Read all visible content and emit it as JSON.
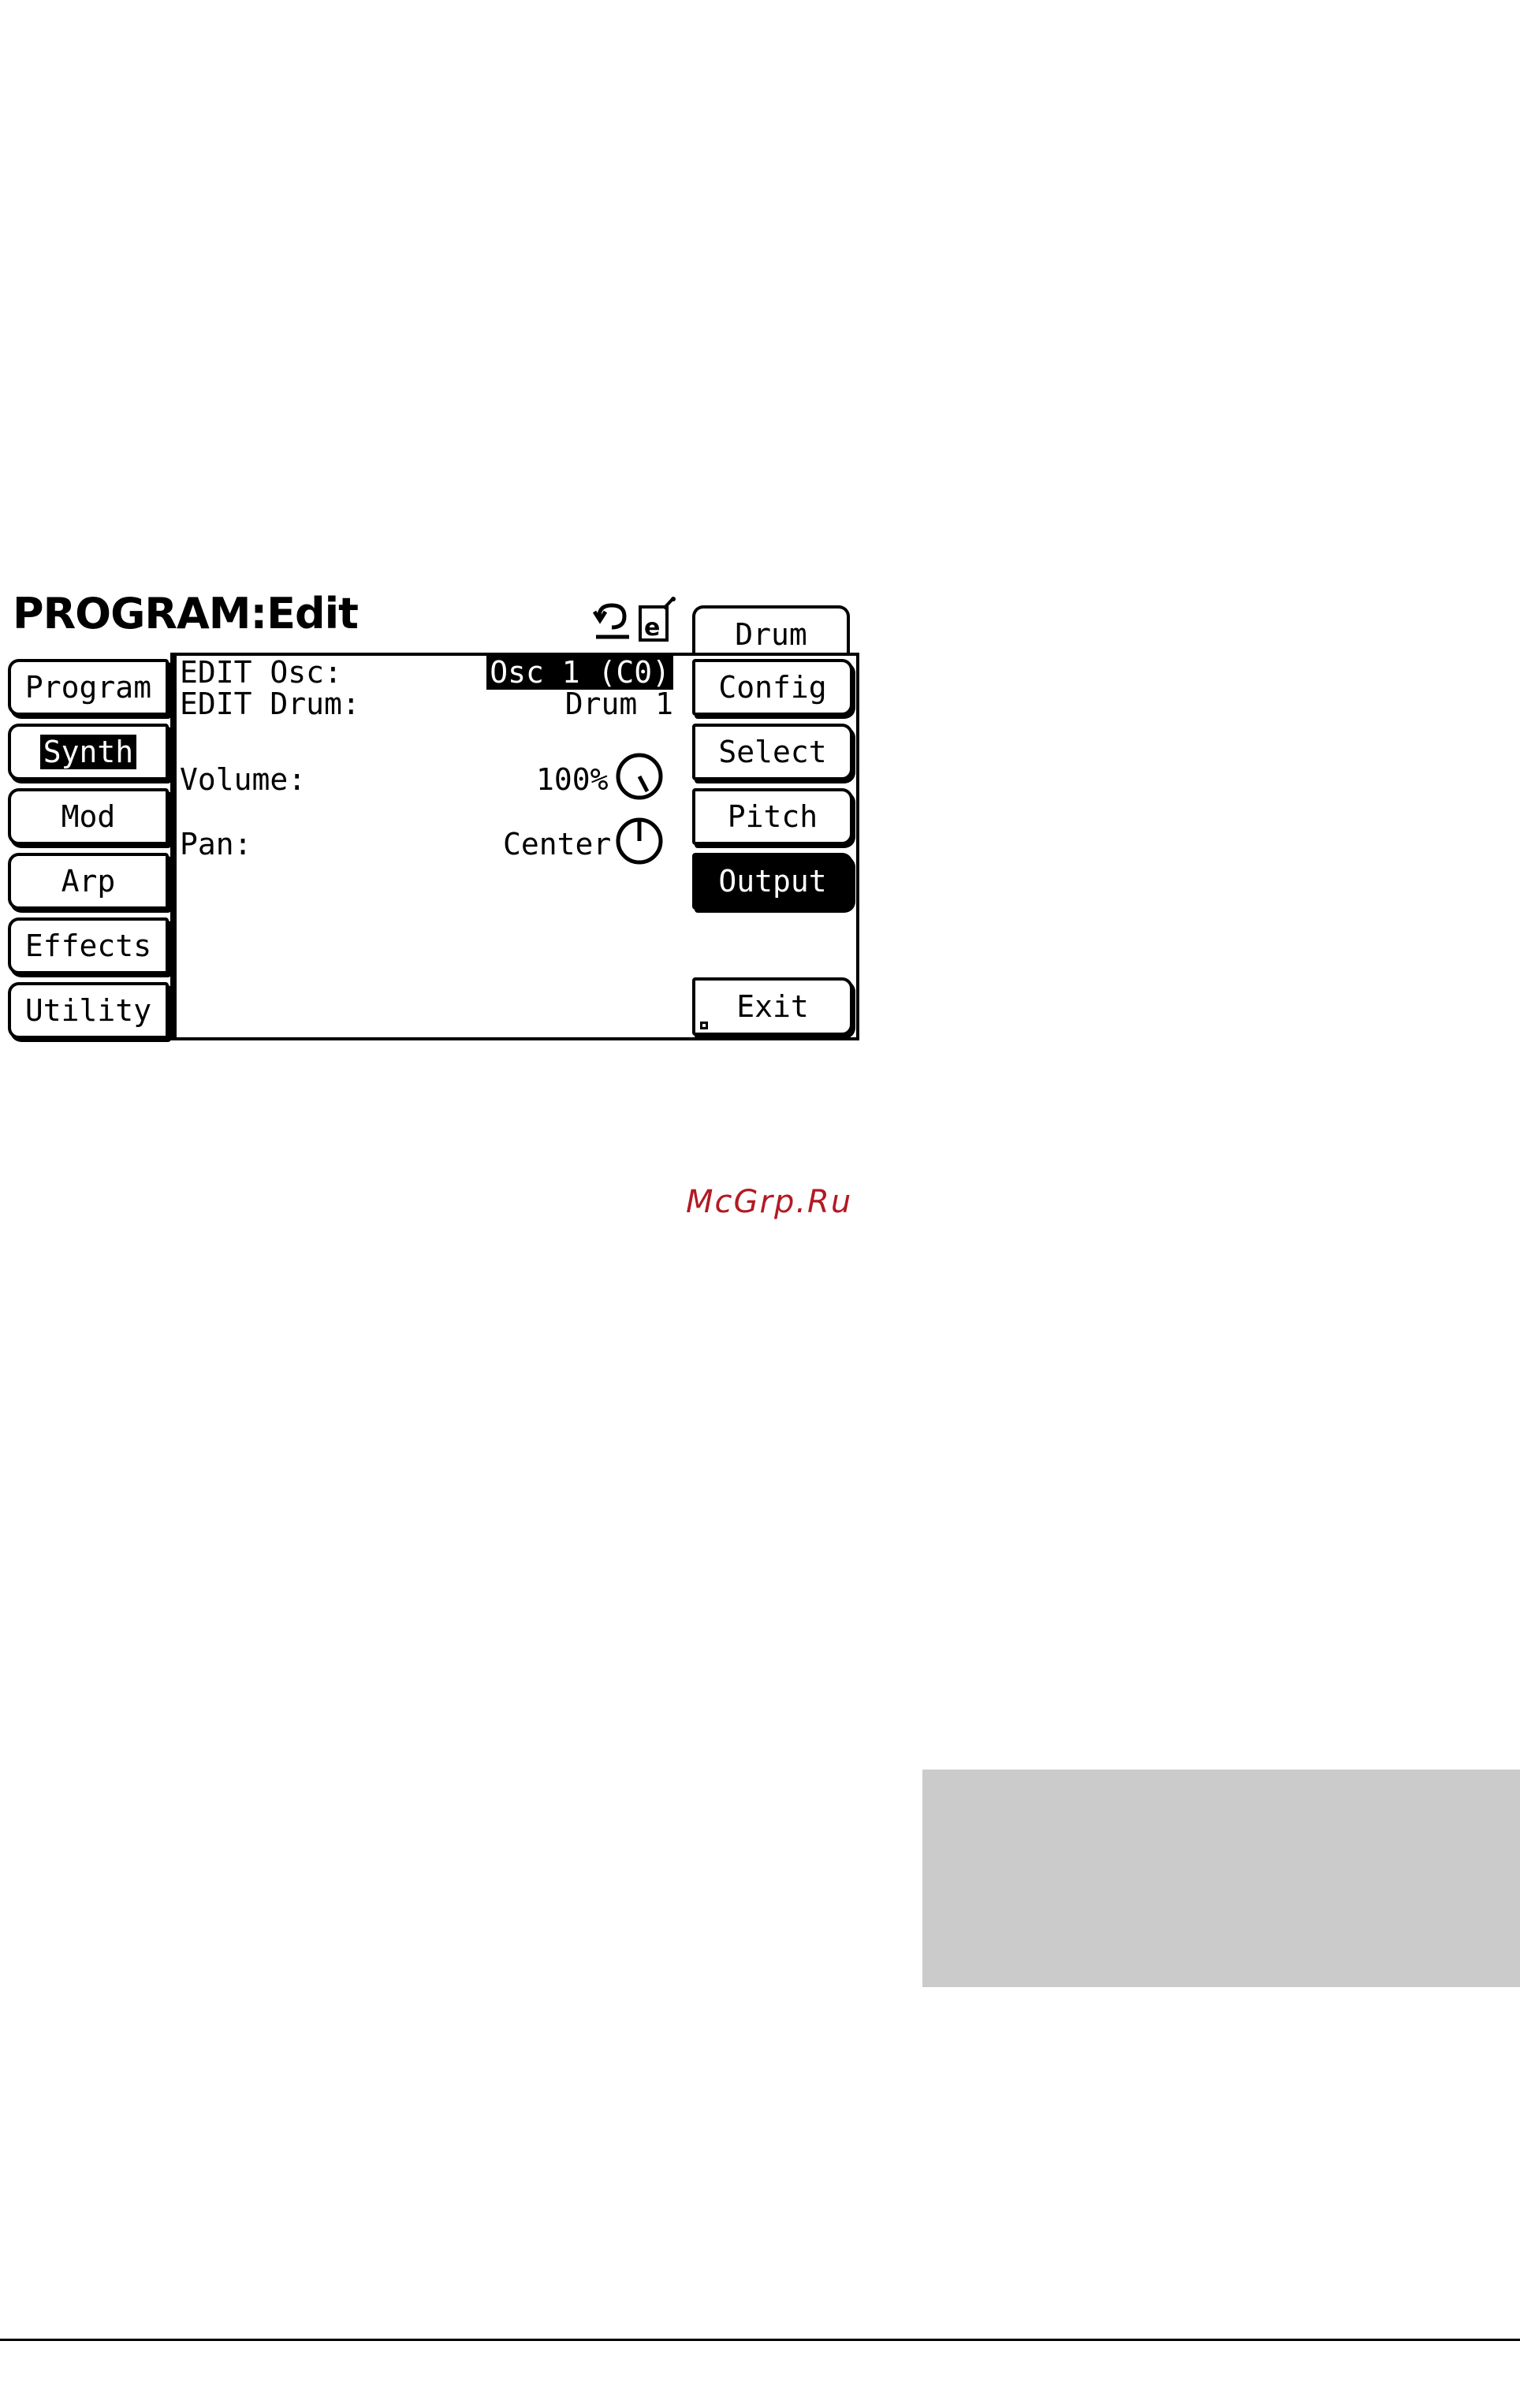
{
  "screen": {
    "title": "PROGRAM:Edit",
    "icons": [
      "undo-icon",
      "edit-document-icon"
    ],
    "left_tabs": [
      {
        "label": "Program",
        "active": false
      },
      {
        "label": "Synth",
        "active": true
      },
      {
        "label": "Mod",
        "active": false
      },
      {
        "label": "Arp",
        "active": false
      },
      {
        "label": "Effects",
        "active": false
      },
      {
        "label": "Utility",
        "active": false
      }
    ],
    "top_right_tab": "Drum",
    "right_tabs": [
      {
        "label": "Config",
        "active": false
      },
      {
        "label": "Select",
        "active": false
      },
      {
        "label": "Pitch",
        "active": false
      },
      {
        "label": "Output",
        "active": true
      }
    ],
    "exit_label": "Exit",
    "params": {
      "edit_osc_label": "EDIT Osc:",
      "edit_osc_value": "Osc 1 (C0)",
      "edit_drum_label": "EDIT Drum:",
      "edit_drum_value": "Drum 1",
      "volume_label": "Volume:",
      "volume_value": "100%",
      "pan_label": "Pan:",
      "pan_value": "Center"
    }
  },
  "watermark": "McGrp.Ru"
}
